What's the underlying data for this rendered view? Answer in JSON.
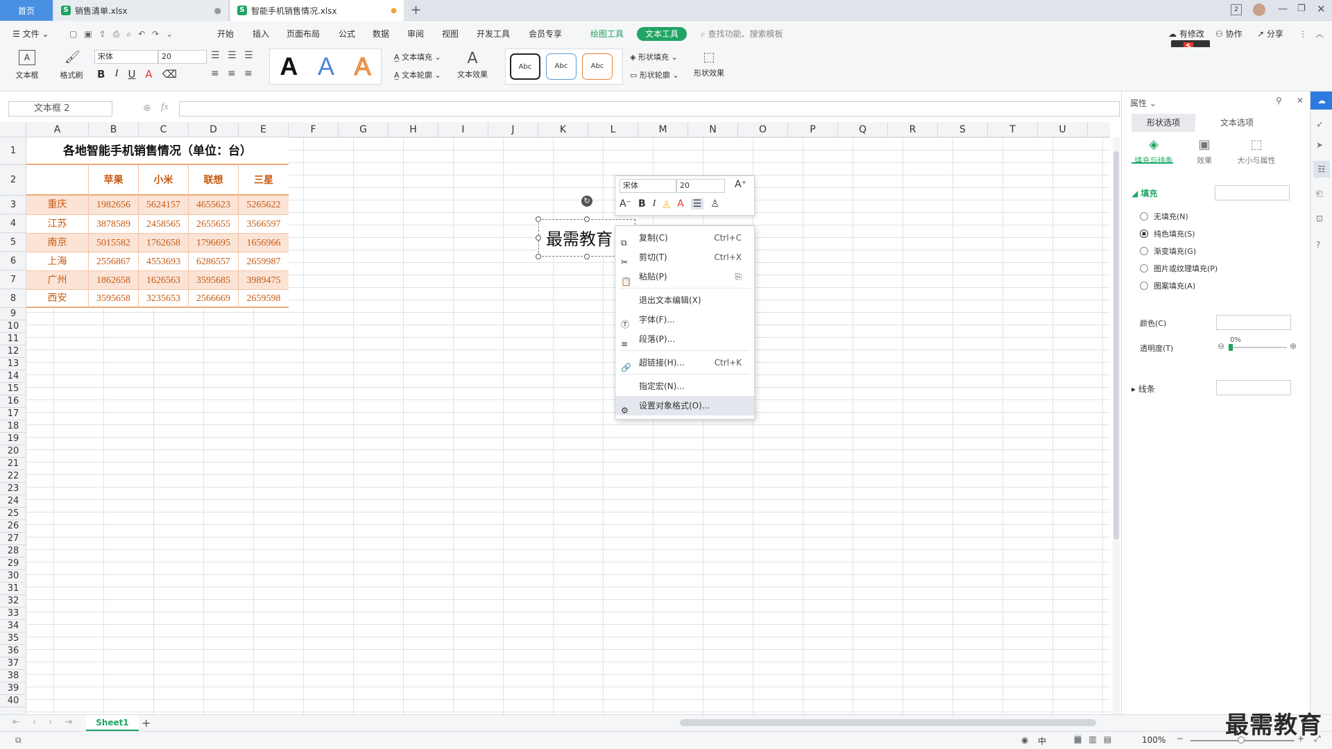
{
  "tabs": [
    {
      "label": "首页"
    },
    {
      "label": "销售清单.xlsx"
    },
    {
      "label": "智能手机销售情况.xlsx"
    }
  ],
  "menu": {
    "file": "文件",
    "items": [
      "开始",
      "插入",
      "页面布局",
      "公式",
      "数据",
      "审阅",
      "视图",
      "开发工具",
      "会员专享"
    ],
    "drawing_tools": "绘图工具",
    "text_tools": "文本工具",
    "search": "查找功能、搜索模板",
    "unsaved": "有修改",
    "collab": "协作",
    "share": "分享"
  },
  "ribbon": {
    "textbox": "文本框",
    "format_painter": "格式刷",
    "font_name": "宋体",
    "font_size": "20",
    "big_a": "A",
    "text_fill": "文本填充",
    "text_outline": "文本轮廓",
    "text_effect": "文本效果",
    "abc": "Abc",
    "shape_fill": "形状填充",
    "shape_outline": "形状轮廓",
    "shape_effect": "形状效果"
  },
  "formula_bar": {
    "name_box": "文本框 2",
    "fx": "fx",
    "value": ""
  },
  "columns": [
    "A",
    "B",
    "C",
    "D",
    "E",
    "F",
    "G",
    "H",
    "I",
    "J",
    "K",
    "L",
    "M",
    "N",
    "O",
    "P",
    "Q",
    "R",
    "S",
    "T",
    "U"
  ],
  "rows": [
    "1",
    "2",
    "3",
    "4",
    "5",
    "6",
    "7",
    "8",
    "9",
    "10",
    "11",
    "12",
    "13",
    "14",
    "15",
    "16",
    "17",
    "18",
    "19",
    "20",
    "21",
    "22",
    "23",
    "24",
    "25",
    "26",
    "27",
    "28",
    "29",
    "30",
    "31",
    "32",
    "33",
    "34",
    "35",
    "36",
    "37",
    "38",
    "39",
    "40"
  ],
  "sheet": {
    "title": "各地智能手机销售情况（单位：台）",
    "headers": [
      "苹果",
      "小米",
      "联想",
      "三星"
    ],
    "data": [
      {
        "city": "重庆",
        "values": [
          "1982656",
          "5624157",
          "4655623",
          "5265622"
        ]
      },
      {
        "city": "江苏",
        "values": [
          "3878589",
          "2458565",
          "2655655",
          "3566597"
        ]
      },
      {
        "city": "南京",
        "values": [
          "5015582",
          "1762658",
          "1796695",
          "1656966"
        ]
      },
      {
        "city": "上海",
        "values": [
          "2556867",
          "4553693",
          "6286557",
          "2659987"
        ]
      },
      {
        "city": "广州",
        "values": [
          "1862658",
          "1626563",
          "3595685",
          "3989475"
        ]
      },
      {
        "city": "西安",
        "values": [
          "3595658",
          "3235653",
          "2566669",
          "2659598"
        ]
      }
    ]
  },
  "textbox_content": "最需教育",
  "mini_toolbar": {
    "font": "宋体",
    "size": "20"
  },
  "context_menu": {
    "items": [
      {
        "label": "复制(C)",
        "shortcut": "Ctrl+C"
      },
      {
        "label": "剪切(T)",
        "shortcut": "Ctrl+X"
      },
      {
        "label": "粘贴(P)",
        "shortcut": ""
      },
      {
        "label": "退出文本编辑(X)",
        "shortcut": ""
      },
      {
        "label": "字体(F)...",
        "shortcut": ""
      },
      {
        "label": "段落(P)...",
        "shortcut": ""
      },
      {
        "label": "超链接(H)...",
        "shortcut": "Ctrl+K"
      },
      {
        "label": "指定宏(N)...",
        "shortcut": ""
      },
      {
        "label": "设置对象格式(O)...",
        "shortcut": ""
      }
    ]
  },
  "panel": {
    "title": "属性",
    "tab_shape": "形状选项",
    "tab_text": "文本选项",
    "sub_fill_line": "填充与线条",
    "sub_effect": "效果",
    "sub_size": "大小与属性",
    "fill_section": "填充",
    "fill_options": [
      "无填充(N)",
      "纯色填充(S)",
      "渐变填充(G)",
      "图片或纹理填充(P)",
      "图案填充(A)"
    ],
    "selected_fill": "纯色填充(S)",
    "color_label": "颜色(C)",
    "transparency_label": "透明度(T)",
    "transparency_value": "0%",
    "line_section": "线条"
  },
  "sheet_tab": "Sheet1",
  "status": {
    "lang": "中",
    "zoom": "100%"
  },
  "watermark": "最需教育",
  "colors": {
    "accent": "#1fa464",
    "orange": "#c55a11",
    "band": "#fbe3d6"
  }
}
